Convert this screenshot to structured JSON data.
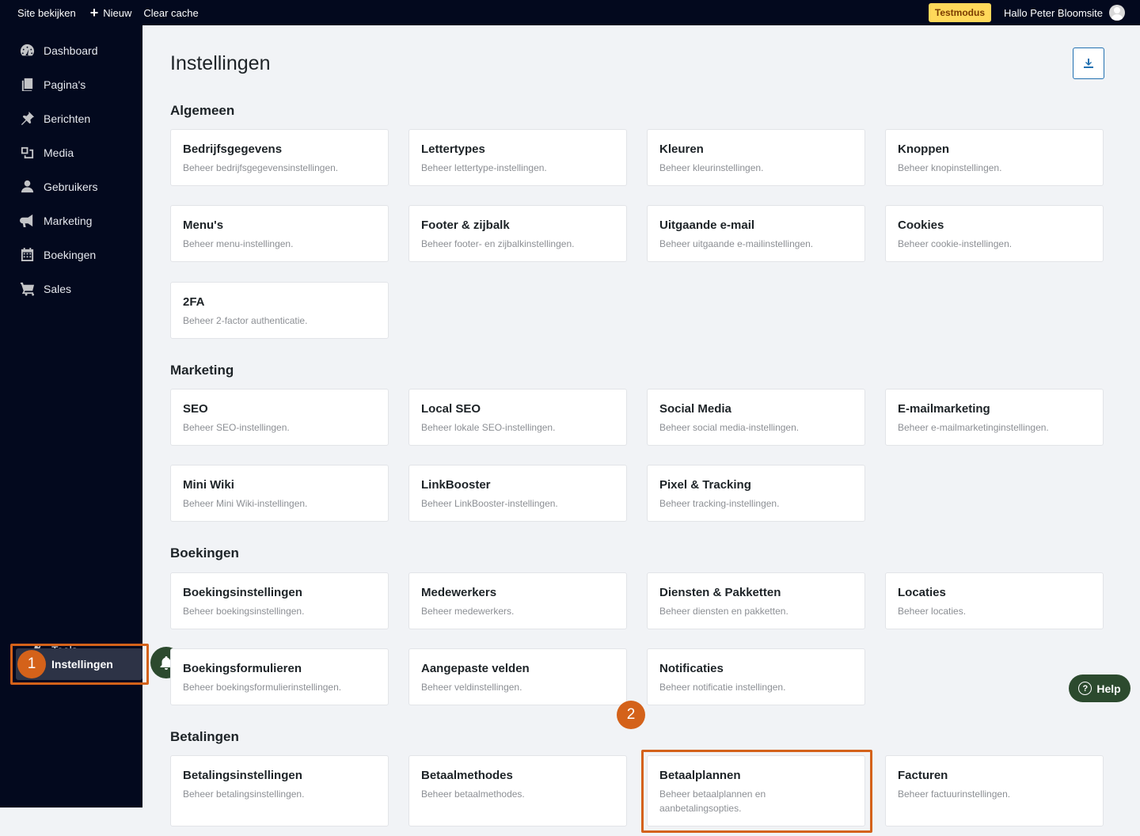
{
  "topbar": {
    "site": "Site bekijken",
    "new": "Nieuw",
    "cache": "Clear cache",
    "testmode": "Testmodus",
    "greeting": "Hallo Peter Bloomsite"
  },
  "sidebar": {
    "items": [
      {
        "label": "Dashboard",
        "icon": "dashboard-icon"
      },
      {
        "label": "Pagina's",
        "icon": "pages-icon"
      },
      {
        "label": "Berichten",
        "icon": "pin-icon"
      },
      {
        "label": "Media",
        "icon": "media-icon"
      },
      {
        "label": "Gebruikers",
        "icon": "user-icon"
      },
      {
        "label": "Marketing",
        "icon": "megaphone-icon"
      },
      {
        "label": "Boekingen",
        "icon": "calendar-icon"
      },
      {
        "label": "Sales",
        "icon": "cart-icon"
      }
    ],
    "tools": "Tools",
    "settings": "Instellingen"
  },
  "steps": {
    "one": "1",
    "two": "2"
  },
  "page": {
    "title": "Instellingen"
  },
  "help": {
    "label": "Help",
    "q": "?"
  },
  "sections": [
    {
      "title": "Algemeen",
      "cards": [
        {
          "title": "Bedrijfsgegevens",
          "desc": "Beheer bedrijfsgegevensinstellingen."
        },
        {
          "title": "Lettertypes",
          "desc": "Beheer lettertype-instellingen."
        },
        {
          "title": "Kleuren",
          "desc": "Beheer kleurinstellingen."
        },
        {
          "title": "Knoppen",
          "desc": "Beheer knopinstellingen."
        },
        {
          "title": "Menu's",
          "desc": "Beheer menu-instellingen."
        },
        {
          "title": "Footer & zijbalk",
          "desc": "Beheer footer- en zijbalkinstellingen."
        },
        {
          "title": "Uitgaande e-mail",
          "desc": "Beheer uitgaande e-mailinstellingen."
        },
        {
          "title": "Cookies",
          "desc": "Beheer cookie-instellingen."
        },
        {
          "title": "2FA",
          "desc": "Beheer 2-factor authenticatie."
        }
      ]
    },
    {
      "title": "Marketing",
      "cards": [
        {
          "title": "SEO",
          "desc": "Beheer SEO-instellingen."
        },
        {
          "title": "Local SEO",
          "desc": "Beheer lokale SEO-instellingen."
        },
        {
          "title": "Social Media",
          "desc": "Beheer social media-instellingen."
        },
        {
          "title": "E-mailmarketing",
          "desc": "Beheer e-mailmarketinginstellingen."
        },
        {
          "title": "Mini Wiki",
          "desc": "Beheer Mini Wiki-instellingen."
        },
        {
          "title": "LinkBooster",
          "desc": "Beheer LinkBooster-instellingen."
        },
        {
          "title": "Pixel & Tracking",
          "desc": "Beheer tracking-instellingen."
        }
      ]
    },
    {
      "title": "Boekingen",
      "cards": [
        {
          "title": "Boekingsinstellingen",
          "desc": "Beheer boekingsinstellingen."
        },
        {
          "title": "Medewerkers",
          "desc": "Beheer medewerkers."
        },
        {
          "title": "Diensten & Pakketten",
          "desc": "Beheer diensten en pakketten."
        },
        {
          "title": "Locaties",
          "desc": "Beheer locaties."
        },
        {
          "title": "Boekingsformulieren",
          "desc": "Beheer boekingsformulierinstellingen."
        },
        {
          "title": "Aangepaste velden",
          "desc": "Beheer veldinstellingen."
        },
        {
          "title": "Notificaties",
          "desc": "Beheer notificatie instellingen."
        }
      ]
    },
    {
      "title": "Betalingen",
      "cards": [
        {
          "title": "Betalingsinstellingen",
          "desc": "Beheer betalingsinstellingen."
        },
        {
          "title": "Betaalmethodes",
          "desc": "Beheer betaalmethodes."
        },
        {
          "title": "Betaalplannen",
          "desc": "Beheer betaalplannen en aanbetalingsopties."
        },
        {
          "title": "Facturen",
          "desc": "Beheer factuurinstellingen."
        }
      ]
    }
  ]
}
